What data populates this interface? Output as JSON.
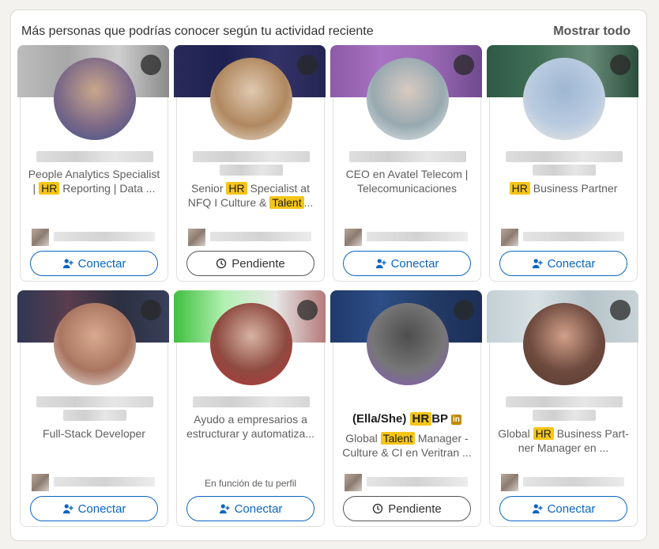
{
  "header": {
    "title": "Más personas que podrías conocer según tu actividad reciente",
    "show_all": "Mostrar todo"
  },
  "colors": {
    "accent": "#0a66c2",
    "highlight": "#f5c518"
  },
  "cards": [
    {
      "headline_parts": [
        {
          "t": "People Analytics Specialist | "
        },
        {
          "t": "HR",
          "hl": true
        },
        {
          "t": " Reporting | Data ..."
        }
      ],
      "button": "Conectar"
    },
    {
      "headline_parts": [
        {
          "t": "Senior "
        },
        {
          "t": "HR",
          "hl": true
        },
        {
          "t": " Specialist at NFQ I Culture & "
        },
        {
          "t": "Talent",
          "hl": true
        },
        {
          "t": "..."
        }
      ],
      "button": "Pendiente"
    },
    {
      "headline_parts": [
        {
          "t": "CEO en Avatel Telecom | Telecomunicaciones"
        }
      ],
      "button": "Conectar"
    },
    {
      "headline_parts": [
        {
          "t": "HR",
          "hl": true
        },
        {
          "t": " Business Partner"
        }
      ],
      "button": "Conectar"
    },
    {
      "headline_parts": [
        {
          "t": "Full-Stack Developer"
        }
      ],
      "button": "Conectar"
    },
    {
      "headline_parts": [
        {
          "t": "Ayudo a empresarios a estructurar y automatiza..."
        }
      ],
      "insight_note": "En función de tu perfil",
      "button": "Conectar"
    },
    {
      "name_parts": [
        {
          "t": "(Ella/She) "
        },
        {
          "t": "HR",
          "hl": true
        },
        {
          "t": "BP"
        }
      ],
      "headline_parts": [
        {
          "t": "Global "
        },
        {
          "t": "Talent",
          "hl": true
        },
        {
          "t": " Manager - Culture & CI en Veritran ..."
        }
      ],
      "button": "Pendiente"
    },
    {
      "headline_parts": [
        {
          "t": "Global "
        },
        {
          "t": "HR",
          "hl": true
        },
        {
          "t": " Business Part-ner Manager en ..."
        }
      ],
      "button": "Conectar"
    }
  ]
}
